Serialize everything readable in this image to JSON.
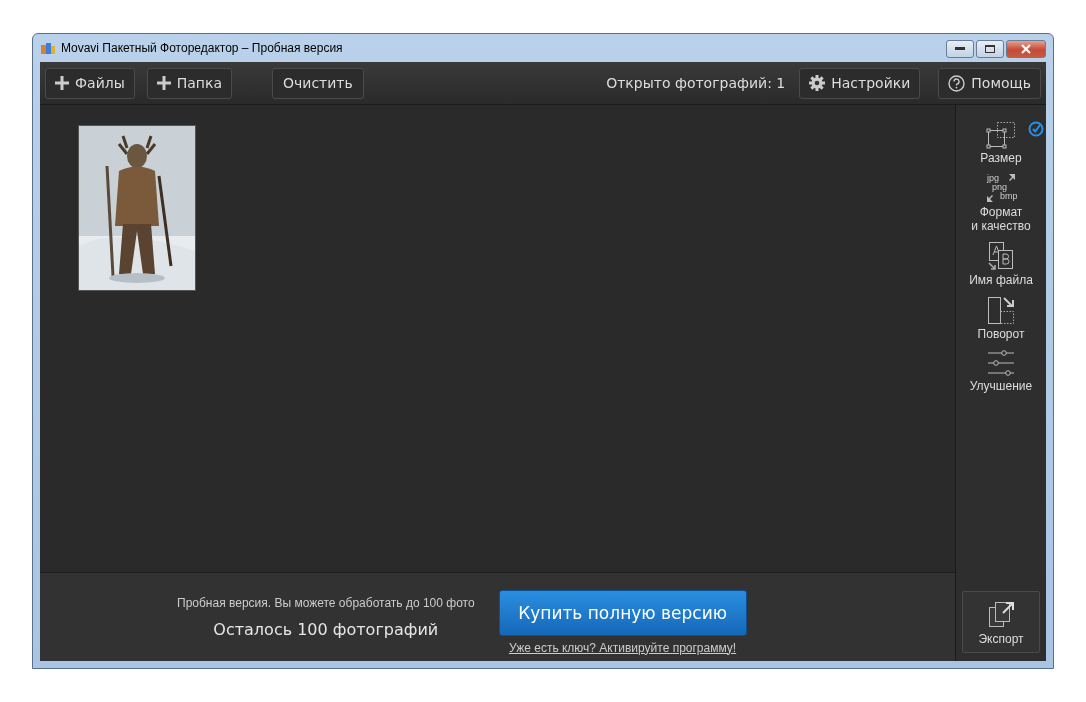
{
  "window": {
    "title": "Movavi Пакетный Фоторедактор – Пробная версия"
  },
  "toolbar": {
    "left_buttons": [
      {
        "label": "Файлы",
        "kind": "add"
      },
      {
        "label": "Папка",
        "kind": "add"
      },
      {
        "label": "Очистить",
        "kind": "plain"
      }
    ],
    "photo_count": "Открыто фотографий: 1",
    "right_buttons": [
      {
        "label": "Настройки",
        "kind": "settings"
      },
      {
        "label": "Помощь",
        "kind": "help"
      }
    ]
  },
  "tools": [
    {
      "label": "Размер",
      "kind": "resize",
      "checked": true
    },
    {
      "label": "Формат\nи качество",
      "kind": "format",
      "checked": false,
      "icon_text": [
        "jpg",
        "png",
        "bmp"
      ]
    },
    {
      "label": "Имя файла",
      "kind": "rename",
      "checked": false
    },
    {
      "label": "Поворот",
      "kind": "rotate",
      "checked": false
    },
    {
      "label": "Улучшение",
      "kind": "enhance",
      "checked": false
    }
  ],
  "trial": {
    "notice": "Пробная версия. Вы можете обработать до 100 фото",
    "remaining": "Осталось 100 фотографий",
    "buy_button": "Купить полную версию",
    "activate_link": "Уже есть ключ? Активируйте программу!"
  },
  "export_button": "Экспорт"
}
